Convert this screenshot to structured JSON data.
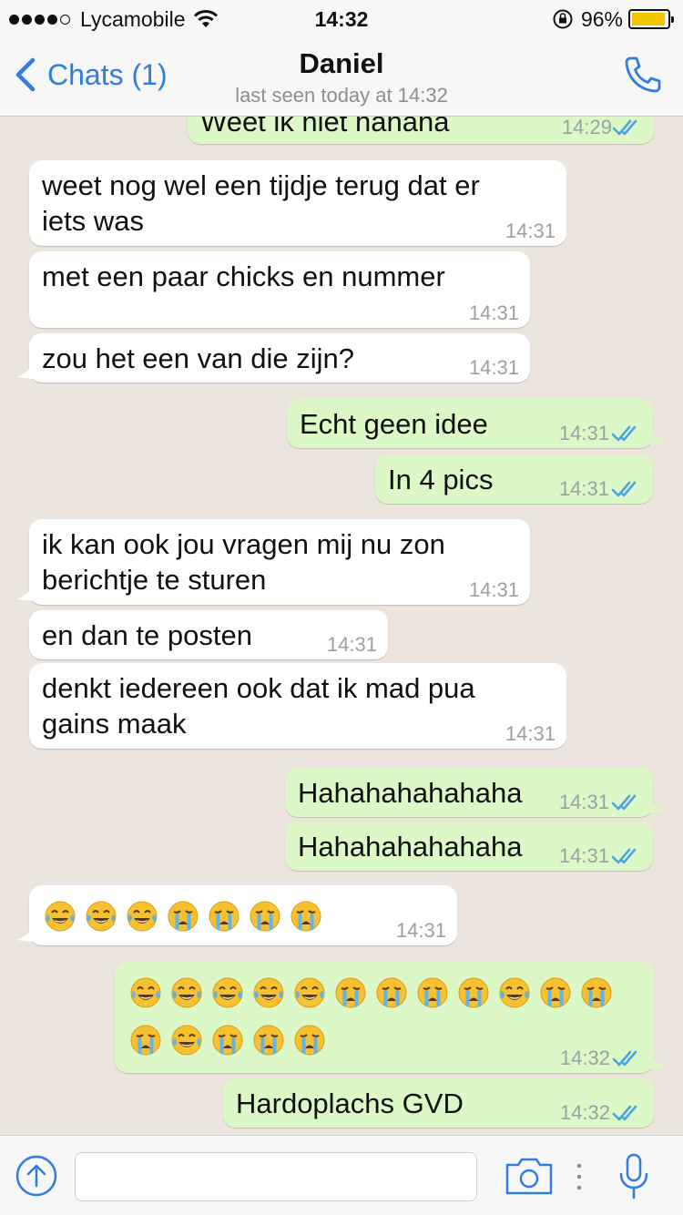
{
  "status_bar": {
    "carrier": "Lycamobile",
    "time": "14:32",
    "battery": "96%",
    "battery_level": 0.96
  },
  "header": {
    "back_label": "Chats (1)",
    "contact_name": "Daniel",
    "last_seen": "last seen today at 14:32"
  },
  "messages": [
    {
      "dir": "out",
      "text": "Weet ik niet hahaha",
      "time": "14:29",
      "read": true
    },
    {
      "dir": "in",
      "lines": [
        "weet nog wel een tijdje terug dat er",
        "iets was"
      ],
      "time": "14:31"
    },
    {
      "dir": "in",
      "lines": [
        "met een paar chicks en nummer"
      ],
      "time": "14:31"
    },
    {
      "dir": "in",
      "lines": [
        "zou het een van die zijn?"
      ],
      "time": "14:31"
    },
    {
      "dir": "out",
      "lines": [
        "Echt geen idee"
      ],
      "time": "14:31",
      "read": true
    },
    {
      "dir": "out",
      "lines": [
        "In 4 pics"
      ],
      "time": "14:31",
      "read": true
    },
    {
      "dir": "in",
      "lines": [
        "ik kan ook jou vragen mij nu zon",
        "berichtje te sturen"
      ],
      "time": "14:31"
    },
    {
      "dir": "in",
      "lines": [
        "en dan te posten"
      ],
      "time": "14:31"
    },
    {
      "dir": "in",
      "lines": [
        "denkt iedereen ook dat ik mad pua",
        "gains maak"
      ],
      "time": "14:31"
    },
    {
      "dir": "out",
      "lines": [
        "Hahahahahahaha"
      ],
      "time": "14:31",
      "read": true
    },
    {
      "dir": "out",
      "lines": [
        "Hahahahahahaha"
      ],
      "time": "14:31",
      "read": true
    },
    {
      "dir": "in",
      "emoji": [
        "joy",
        "joy",
        "joy",
        "sob",
        "sob",
        "sob",
        "sob"
      ],
      "time": "14:31"
    },
    {
      "dir": "out",
      "emoji": [
        "joy",
        "joy",
        "joy",
        "joy",
        "joy",
        "sob",
        "sob",
        "sob",
        "sob",
        "joy",
        "sob",
        "sob",
        "sob",
        "joy",
        "sob",
        "sob",
        "sob"
      ],
      "time": "14:32",
      "read": true
    },
    {
      "dir": "out",
      "lines": [
        "Hardoplachs GVD"
      ],
      "time": "14:32",
      "read": true
    }
  ],
  "composer": {
    "placeholder": ""
  },
  "icons": {
    "back": "chevron-left-icon",
    "call": "phone-icon",
    "upload": "arrow-up-circle-icon",
    "camera": "camera-icon",
    "more": "vertical-dots-icon",
    "mic": "microphone-icon"
  },
  "colors": {
    "accent": "#2f7de1",
    "outgoing": "#dcf8c6",
    "incoming": "#ffffff",
    "background": "#ece5dd",
    "battery": "#f5c400"
  }
}
